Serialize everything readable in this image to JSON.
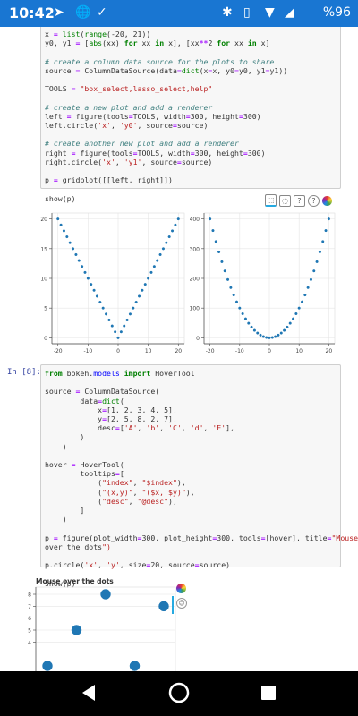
{
  "status": {
    "time": "10:42",
    "battery": "%96",
    "icons": [
      "telegram-icon",
      "globe-icon",
      "download-check-icon",
      "bluetooth-icon",
      "vibrate-icon",
      "wifi-icon",
      "signal-icon"
    ]
  },
  "cell_top": {
    "lines": [
      "x = list(range(-20, 21))",
      "y0, y1 = [abs(xx) for xx in x], [xx**2 for xx in x]",
      "",
      "# create a column data source for the plots to share",
      "source = ColumnDataSource(data=dict(x=x, y0=y0, y1=y1))",
      "",
      "TOOLS = \"box_select,lasso_select,help\"",
      "",
      "# create a new plot and add a renderer",
      "left = figure(tools=TOOLS, width=300, height=300)",
      "left.circle('x', 'y0', source=source)",
      "",
      "# create another new plot and add a renderer",
      "right = figure(tools=TOOLS, width=300, height=300)",
      "right.circle('x', 'y1', source=source)",
      "",
      "p = gridplot([[left, right]])",
      "",
      "show(p)"
    ]
  },
  "cell2": {
    "prompt": "In [8]:",
    "lines": [
      "from bokeh.models import HoverTool",
      "",
      "source = ColumnDataSource(",
      "        data=dict(",
      "            x=[1, 2, 3, 4, 5],",
      "            y=[2, 5, 8, 2, 7],",
      "            desc=['A', 'b', 'C', 'd', 'E'],",
      "        )",
      "    )",
      "",
      "hover = HoverTool(",
      "        tooltips=[",
      "            (\"index\", \"$index\"),",
      "            (\"(x,y)\", \"($x, $y)\"),",
      "            (\"desc\", \"@desc\"),",
      "        ]",
      "    )",
      "",
      "p = figure(plot_width=300, plot_height=300, tools=[hover], title=\"Mouse",
      "over the dots\")",
      "",
      "p.circle('x', 'y', size=20, source=source)",
      "",
      "show(p)"
    ]
  },
  "chart_data": [
    {
      "type": "scatter",
      "title": "",
      "x": [
        -20,
        -19,
        -18,
        -17,
        -16,
        -15,
        -14,
        -13,
        -12,
        -11,
        -10,
        -9,
        -8,
        -7,
        -6,
        -5,
        -4,
        -3,
        -2,
        -1,
        0,
        1,
        2,
        3,
        4,
        5,
        6,
        7,
        8,
        9,
        10,
        11,
        12,
        13,
        14,
        15,
        16,
        17,
        18,
        19,
        20
      ],
      "y": [
        20,
        19,
        18,
        17,
        16,
        15,
        14,
        13,
        12,
        11,
        10,
        9,
        8,
        7,
        6,
        5,
        4,
        3,
        2,
        1,
        0,
        1,
        2,
        3,
        4,
        5,
        6,
        7,
        8,
        9,
        10,
        11,
        12,
        13,
        14,
        15,
        16,
        17,
        18,
        19,
        20
      ],
      "xlim": [
        -22,
        22
      ],
      "ylim": [
        -1,
        21
      ],
      "xticks": [
        -20,
        -10,
        0,
        10,
        20
      ],
      "yticks": [
        0,
        5,
        10,
        15,
        20
      ],
      "xtick_labels": [
        "-20",
        "-10",
        "0",
        "10",
        "20"
      ],
      "ytick_labels": [
        "0",
        "5",
        "10",
        "15",
        "20"
      ],
      "grid": true,
      "color": "#1f77b4"
    },
    {
      "type": "scatter",
      "title": "",
      "x": [
        -20,
        -19,
        -18,
        -17,
        -16,
        -15,
        -14,
        -13,
        -12,
        -11,
        -10,
        -9,
        -8,
        -7,
        -6,
        -5,
        -4,
        -3,
        -2,
        -1,
        0,
        1,
        2,
        3,
        4,
        5,
        6,
        7,
        8,
        9,
        10,
        11,
        12,
        13,
        14,
        15,
        16,
        17,
        18,
        19,
        20
      ],
      "y": [
        400,
        361,
        324,
        289,
        256,
        225,
        196,
        169,
        144,
        121,
        100,
        81,
        64,
        49,
        36,
        25,
        16,
        9,
        4,
        1,
        0,
        1,
        4,
        9,
        16,
        25,
        36,
        49,
        64,
        81,
        100,
        121,
        144,
        169,
        196,
        225,
        256,
        289,
        324,
        361,
        400
      ],
      "xlim": [
        -22,
        22
      ],
      "ylim": [
        -20,
        420
      ],
      "xticks": [
        -20,
        -10,
        0,
        10,
        20
      ],
      "yticks": [
        0,
        100,
        200,
        300,
        400
      ],
      "xtick_labels": [
        "-20",
        "-10",
        "0",
        "10",
        "20"
      ],
      "ytick_labels": [
        "0",
        "100",
        "200",
        "300",
        "400"
      ],
      "grid": true,
      "color": "#1f77b4"
    },
    {
      "type": "scatter",
      "title": "Mouse over the dots",
      "x": [
        1,
        2,
        3,
        4,
        5
      ],
      "y": [
        2,
        5,
        8,
        2,
        7
      ],
      "xlim": [
        0.6,
        5.4
      ],
      "ylim": [
        1.4,
        8.6
      ],
      "yticks": [
        4,
        5,
        6,
        7,
        8
      ],
      "ytick_labels": [
        "4",
        "5",
        "6",
        "7",
        "8"
      ],
      "grid": true,
      "color": "#1f77b4"
    }
  ]
}
